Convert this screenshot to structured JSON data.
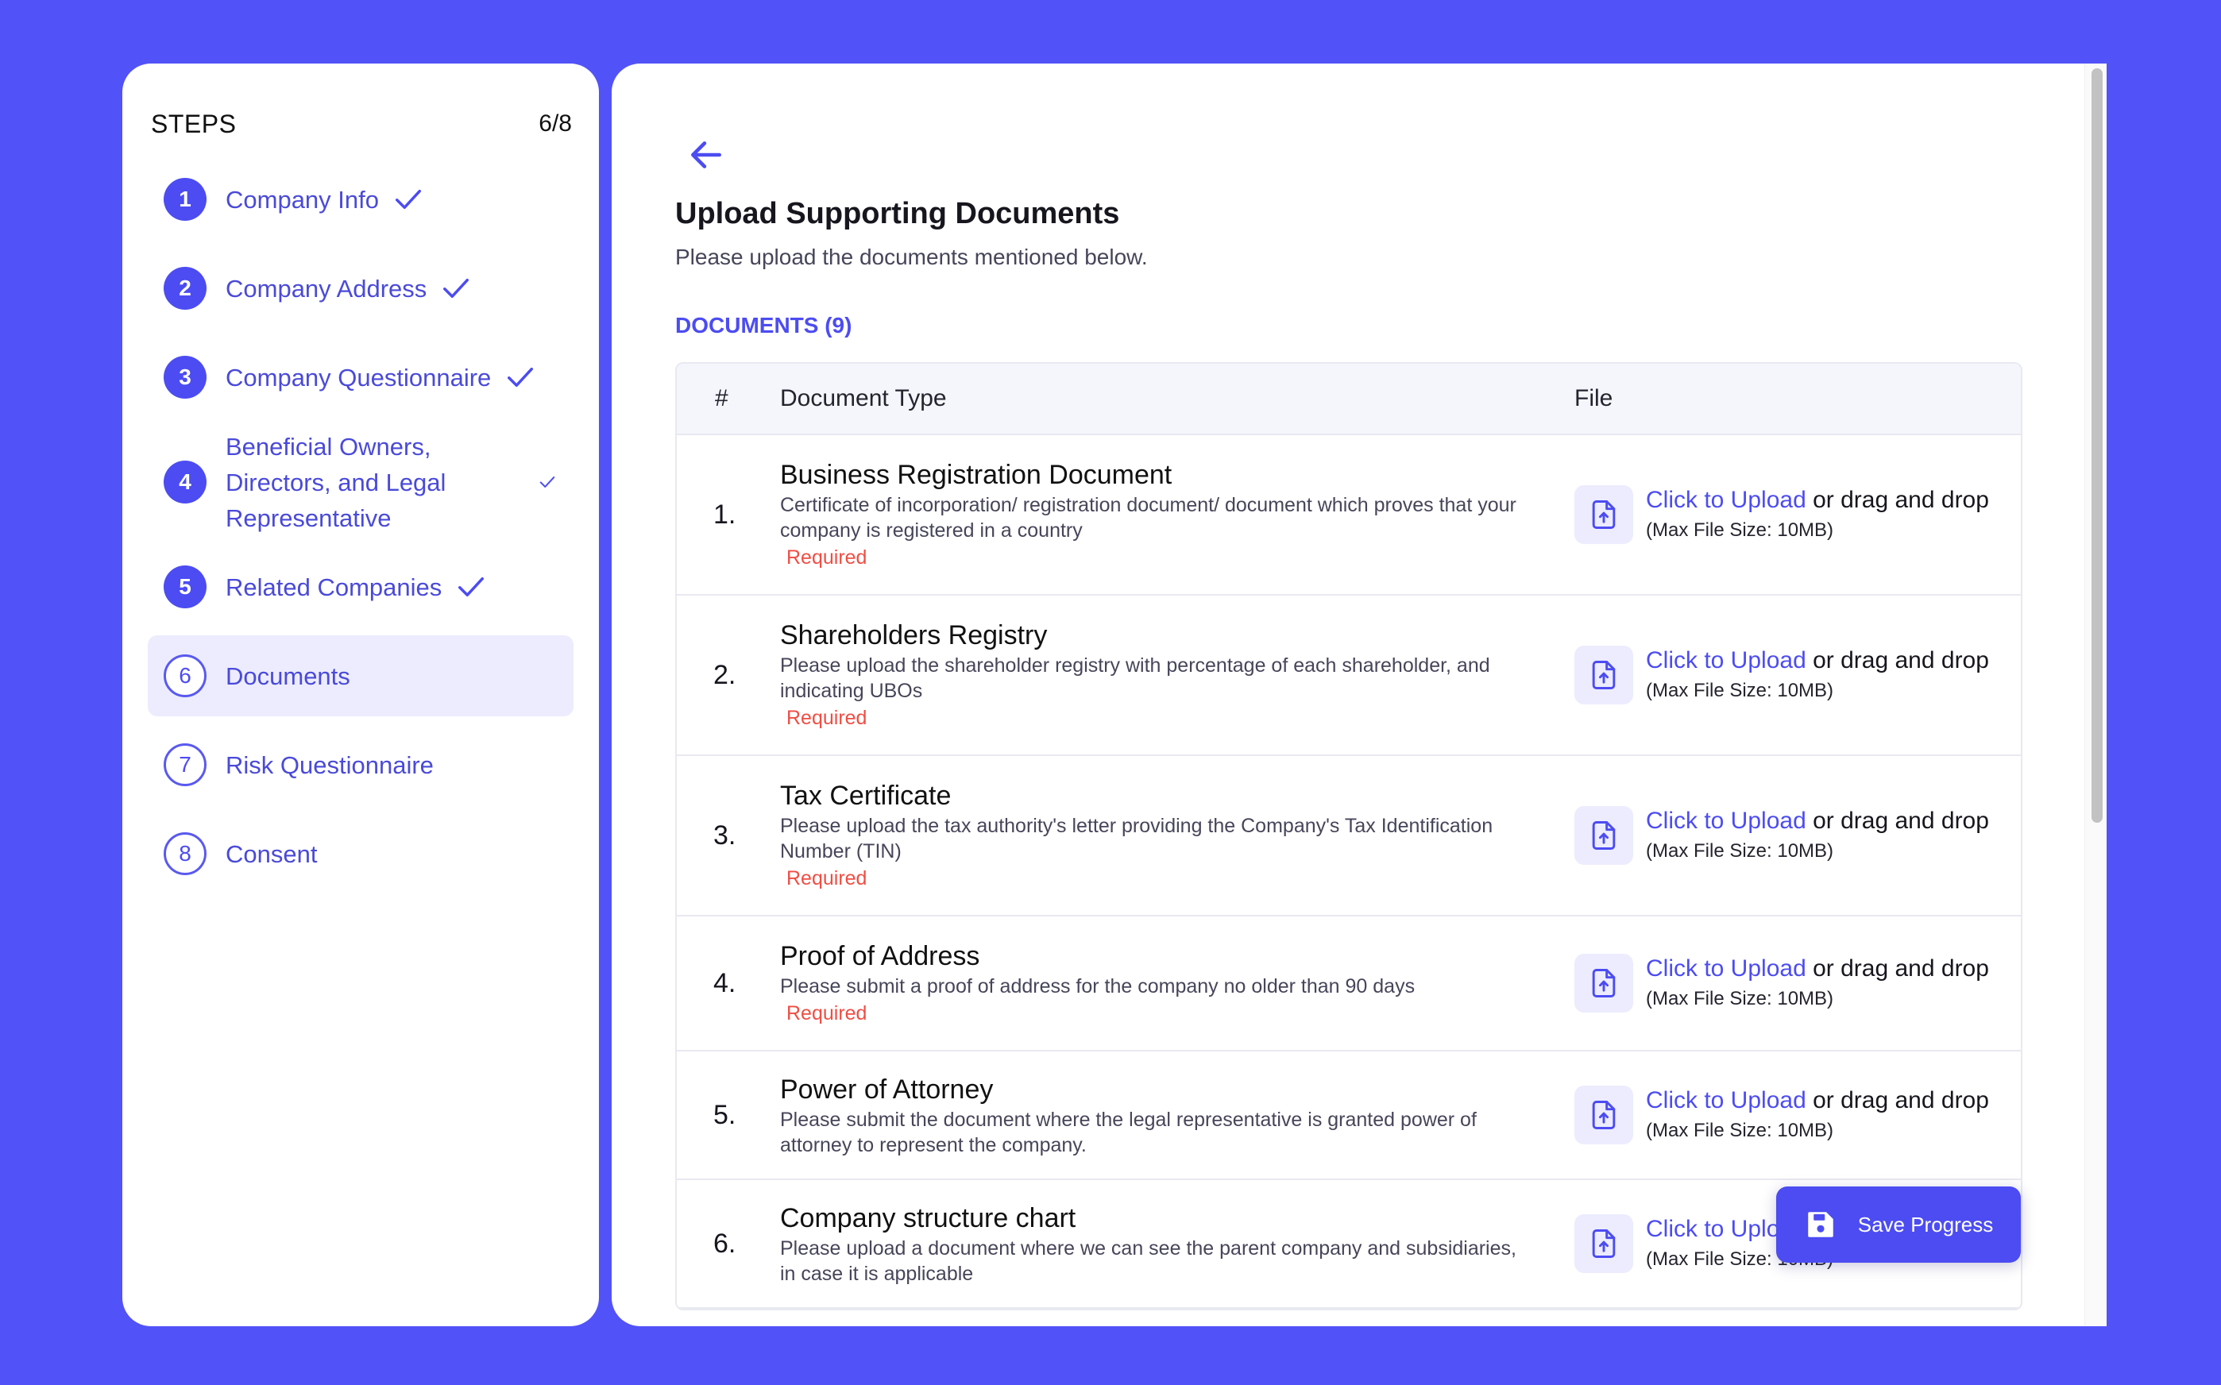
{
  "colors": {
    "accent": "#4c4cf2",
    "background": "#5252f9",
    "required": "#ef4e44"
  },
  "sidebar": {
    "title": "STEPS",
    "progress": "6/8",
    "steps": [
      {
        "num": "1",
        "label": "Company Info",
        "status": "done"
      },
      {
        "num": "2",
        "label": "Company Address",
        "status": "done"
      },
      {
        "num": "3",
        "label": "Company Questionnaire",
        "status": "done"
      },
      {
        "num": "4",
        "label": "Beneficial Owners, Directors, and Legal Representative",
        "status": "done"
      },
      {
        "num": "5",
        "label": "Related Companies",
        "status": "done"
      },
      {
        "num": "6",
        "label": "Documents",
        "status": "active"
      },
      {
        "num": "7",
        "label": "Risk Questionnaire",
        "status": "todo"
      },
      {
        "num": "8",
        "label": "Consent",
        "status": "todo"
      }
    ]
  },
  "main": {
    "back_icon": "arrow-left-icon",
    "title": "Upload Supporting Documents",
    "subtitle": "Please upload the documents mentioned below.",
    "documents_heading": "DOCUMENTS (9)",
    "table": {
      "columns": [
        "#",
        "Document Type",
        "File"
      ],
      "upload_link": "Click to Upload",
      "upload_rest": " or drag and drop",
      "max_size": "(Max File Size: 10MB)",
      "rows": [
        {
          "num": "1.",
          "name": "Business Registration Document",
          "desc": "Certificate of incorporation/ registration document/ document which proves that your company is registered in a country",
          "required": "Required"
        },
        {
          "num": "2.",
          "name": "Shareholders Registry",
          "desc": "Please upload the shareholder registry with percentage of each shareholder, and indicating UBOs",
          "required": "Required"
        },
        {
          "num": "3.",
          "name": "Tax Certificate",
          "desc": "Please upload the tax authority's letter providing the Company's Tax Identification Number (TIN)",
          "required": "Required"
        },
        {
          "num": "4.",
          "name": "Proof of Address",
          "desc": "Please submit a proof of address for the company no older than 90 days",
          "required": "Required"
        },
        {
          "num": "5.",
          "name": "Power of Attorney",
          "desc": "Please submit the document where the legal representative is granted power of attorney to represent the company.",
          "required": ""
        },
        {
          "num": "6.",
          "name": "Company structure chart",
          "desc": "Please upload a document where we can see the parent company and subsidiaries, in case it is applicable",
          "required": ""
        }
      ]
    },
    "save_button": "Save Progress"
  }
}
